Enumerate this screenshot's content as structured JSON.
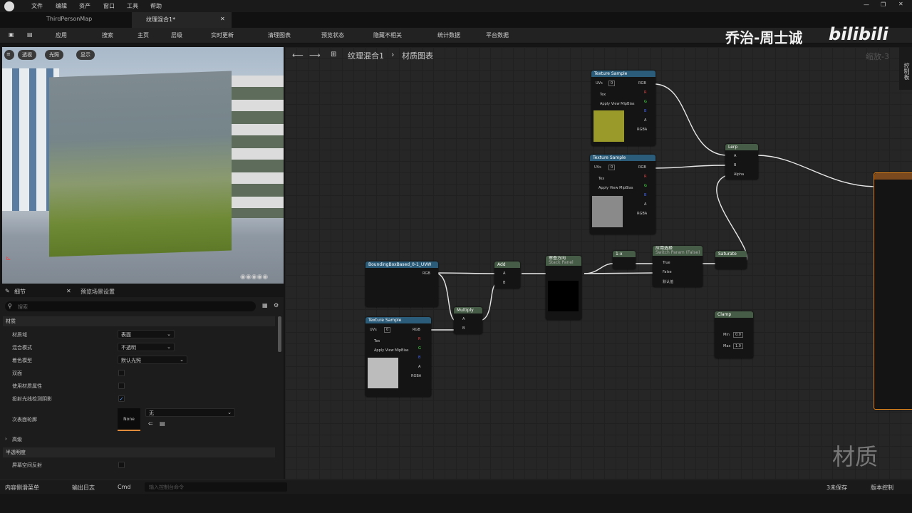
{
  "menu": [
    "文件",
    "编辑",
    "资产",
    "窗口",
    "工具",
    "帮助"
  ],
  "tabs": [
    {
      "label": "ThirdPersonMap"
    },
    {
      "label": "纹理混合1*"
    }
  ],
  "toolbar": {
    "apply": "应用",
    "search": "搜索",
    "home": "主页",
    "hierarchy": "层级",
    "live_update": "实时更新",
    "clean_graph": "清理图表",
    "preview_state": "预览状态",
    "hide_unrelated": "隐藏不相关",
    "stats": "统计数据",
    "platform_stats": "平台数据"
  },
  "watermark": {
    "author": "乔治-周士诚",
    "site": "bilibili",
    "material": "材质"
  },
  "viewport": {
    "perspective": "透视",
    "lit": "光照",
    "show": "显示"
  },
  "details": {
    "tab_details": "细节",
    "tab_preview": "预览场景设置",
    "search_placeholder": "搜索",
    "section_material": "材质",
    "props": [
      {
        "label": "材质域",
        "value": "表面"
      },
      {
        "label": "混合模式",
        "value": "不透明"
      },
      {
        "label": "着色模型",
        "value": "默认光照"
      },
      {
        "label": "双面"
      },
      {
        "label": "使用材质属性"
      },
      {
        "label": "投射光线检测阴影"
      },
      {
        "label": "次表面轮廓",
        "value": "无",
        "thumb": "None"
      }
    ],
    "section_advanced": "高级",
    "section_translucency": "半透明度",
    "ssr": "屏幕空间反射"
  },
  "graph": {
    "breadcrumb_1": "纹理混合1",
    "breadcrumb_2": "材质图表",
    "zoom": "缩放-3",
    "right_panel": "控制板",
    "nodes": {
      "ts1": "Texture Sample",
      "ts2": "Texture Sample",
      "ts3": "Texture Sample",
      "lerp": "Lerp",
      "bbox": "BoundingBoxBased_0-1_UVW",
      "add": "Add",
      "multiply": "Multiply",
      "stack_title": "审查方向",
      "stack_sub": "Stack Panel",
      "oneminus": "1-x",
      "switch": "应用选择",
      "switch_sub": "Switch Param (False)",
      "saturate": "Saturate",
      "clamp": "Clamp",
      "clamp_min": "0.0",
      "clamp_max": "1.0",
      "true": "True",
      "false": "False",
      "default": "默认值"
    },
    "pins_ts": [
      "UVs",
      "Tex",
      "Apply View MipBias"
    ],
    "outputs_ts": [
      "RGB",
      "R",
      "G",
      "B",
      "A",
      "RGBA"
    ],
    "uvs_value": "0",
    "lerp_pins": [
      "A",
      "B",
      "Alpha"
    ],
    "ab_pins": [
      "A",
      "B"
    ],
    "minmax": [
      "Min",
      "Max"
    ]
  },
  "status": {
    "content_drawer": "内容侧滑菜单",
    "output_log": "输出日志",
    "cmd": "Cmd",
    "console_placeholder": "输入控制台命令",
    "unsaved": "3未保存",
    "source_control": "版本控制"
  }
}
